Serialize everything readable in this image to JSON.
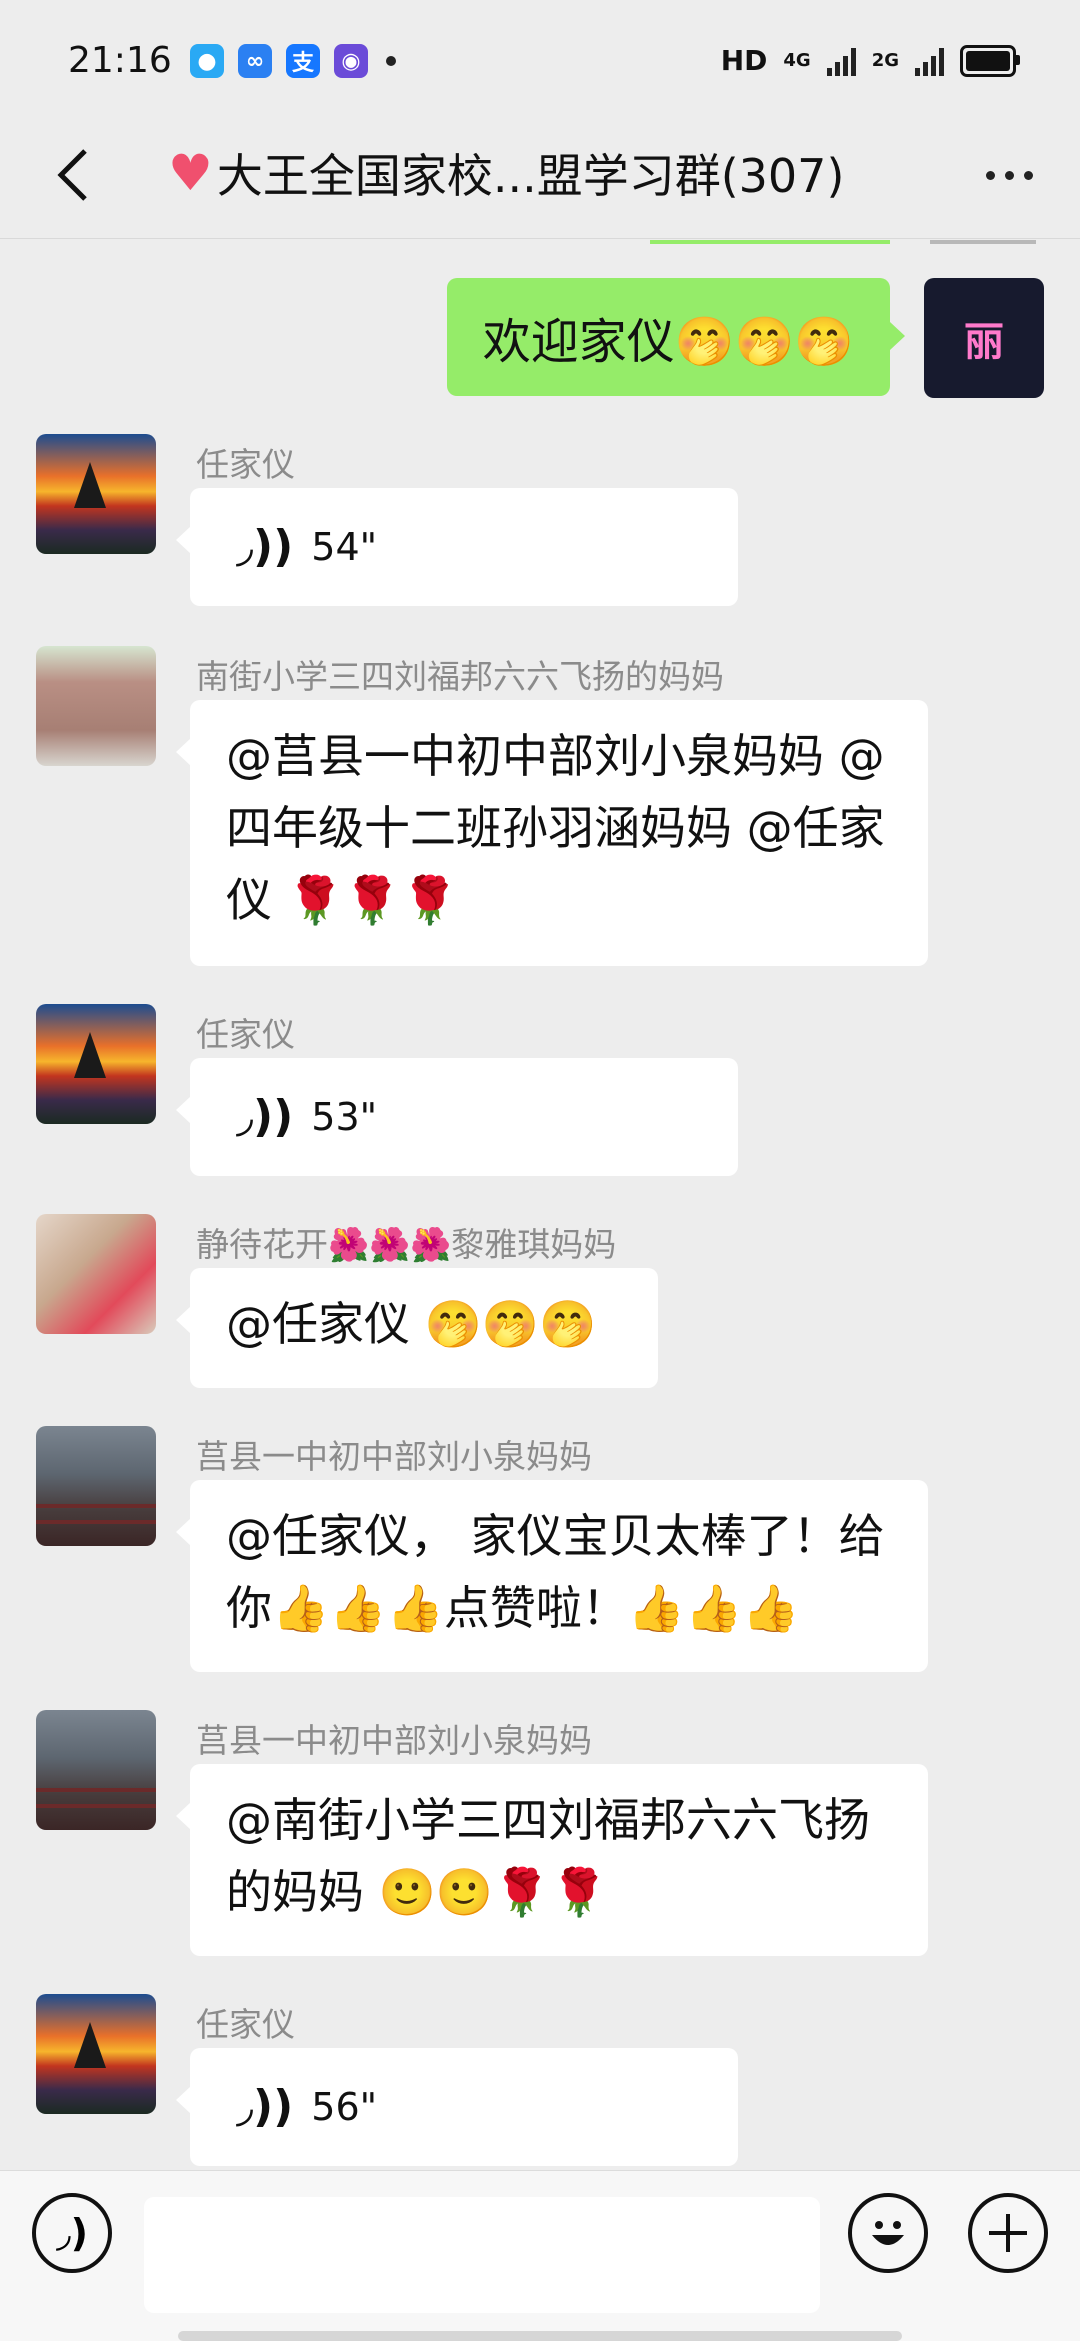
{
  "status_bar": {
    "time": "21:16",
    "hd_label": "HD",
    "network_4g": "4G",
    "network_2g": "2G"
  },
  "nav": {
    "title": "大王全国家校...盟学习群(307)"
  },
  "self_message": {
    "text": "欢迎家仪🤭🤭🤭",
    "avatar_text": "丽"
  },
  "messages": [
    {
      "sender": "任家仪",
      "type": "voice",
      "duration": "54\""
    },
    {
      "sender": "南街小学三四刘福邦六六飞扬的妈妈",
      "type": "text",
      "text": "@莒县一中初中部刘小泉妈妈 @四年级十二班孙羽涵妈妈 @任家仪 🌹🌹🌹"
    },
    {
      "sender": "任家仪",
      "type": "voice",
      "duration": "53\""
    },
    {
      "sender": "静待花开🌺🌺🌺黎雅琪妈妈",
      "type": "text",
      "text": "@任家仪 🤭🤭🤭"
    },
    {
      "sender": "莒县一中初中部刘小泉妈妈",
      "type": "text",
      "text": "@任家仪， 家仪宝贝太棒了！给你👍👍👍点赞啦！👍👍👍"
    },
    {
      "sender": "莒县一中初中部刘小泉妈妈",
      "type": "text",
      "text": "@南街小学三四刘福邦六六飞扬的妈妈 🙂🙂🌹🌹"
    },
    {
      "sender": "任家仪",
      "type": "voice",
      "duration": "56\""
    }
  ],
  "icons": {
    "back": "chevron-left-icon",
    "more": "more-dots-icon",
    "voice": "voice-wave-icon",
    "emoji": "smile-icon",
    "plus": "plus-icon"
  },
  "colors": {
    "self_bubble": "#95ec69",
    "other_bubble": "#ffffff",
    "background": "#ededed"
  }
}
